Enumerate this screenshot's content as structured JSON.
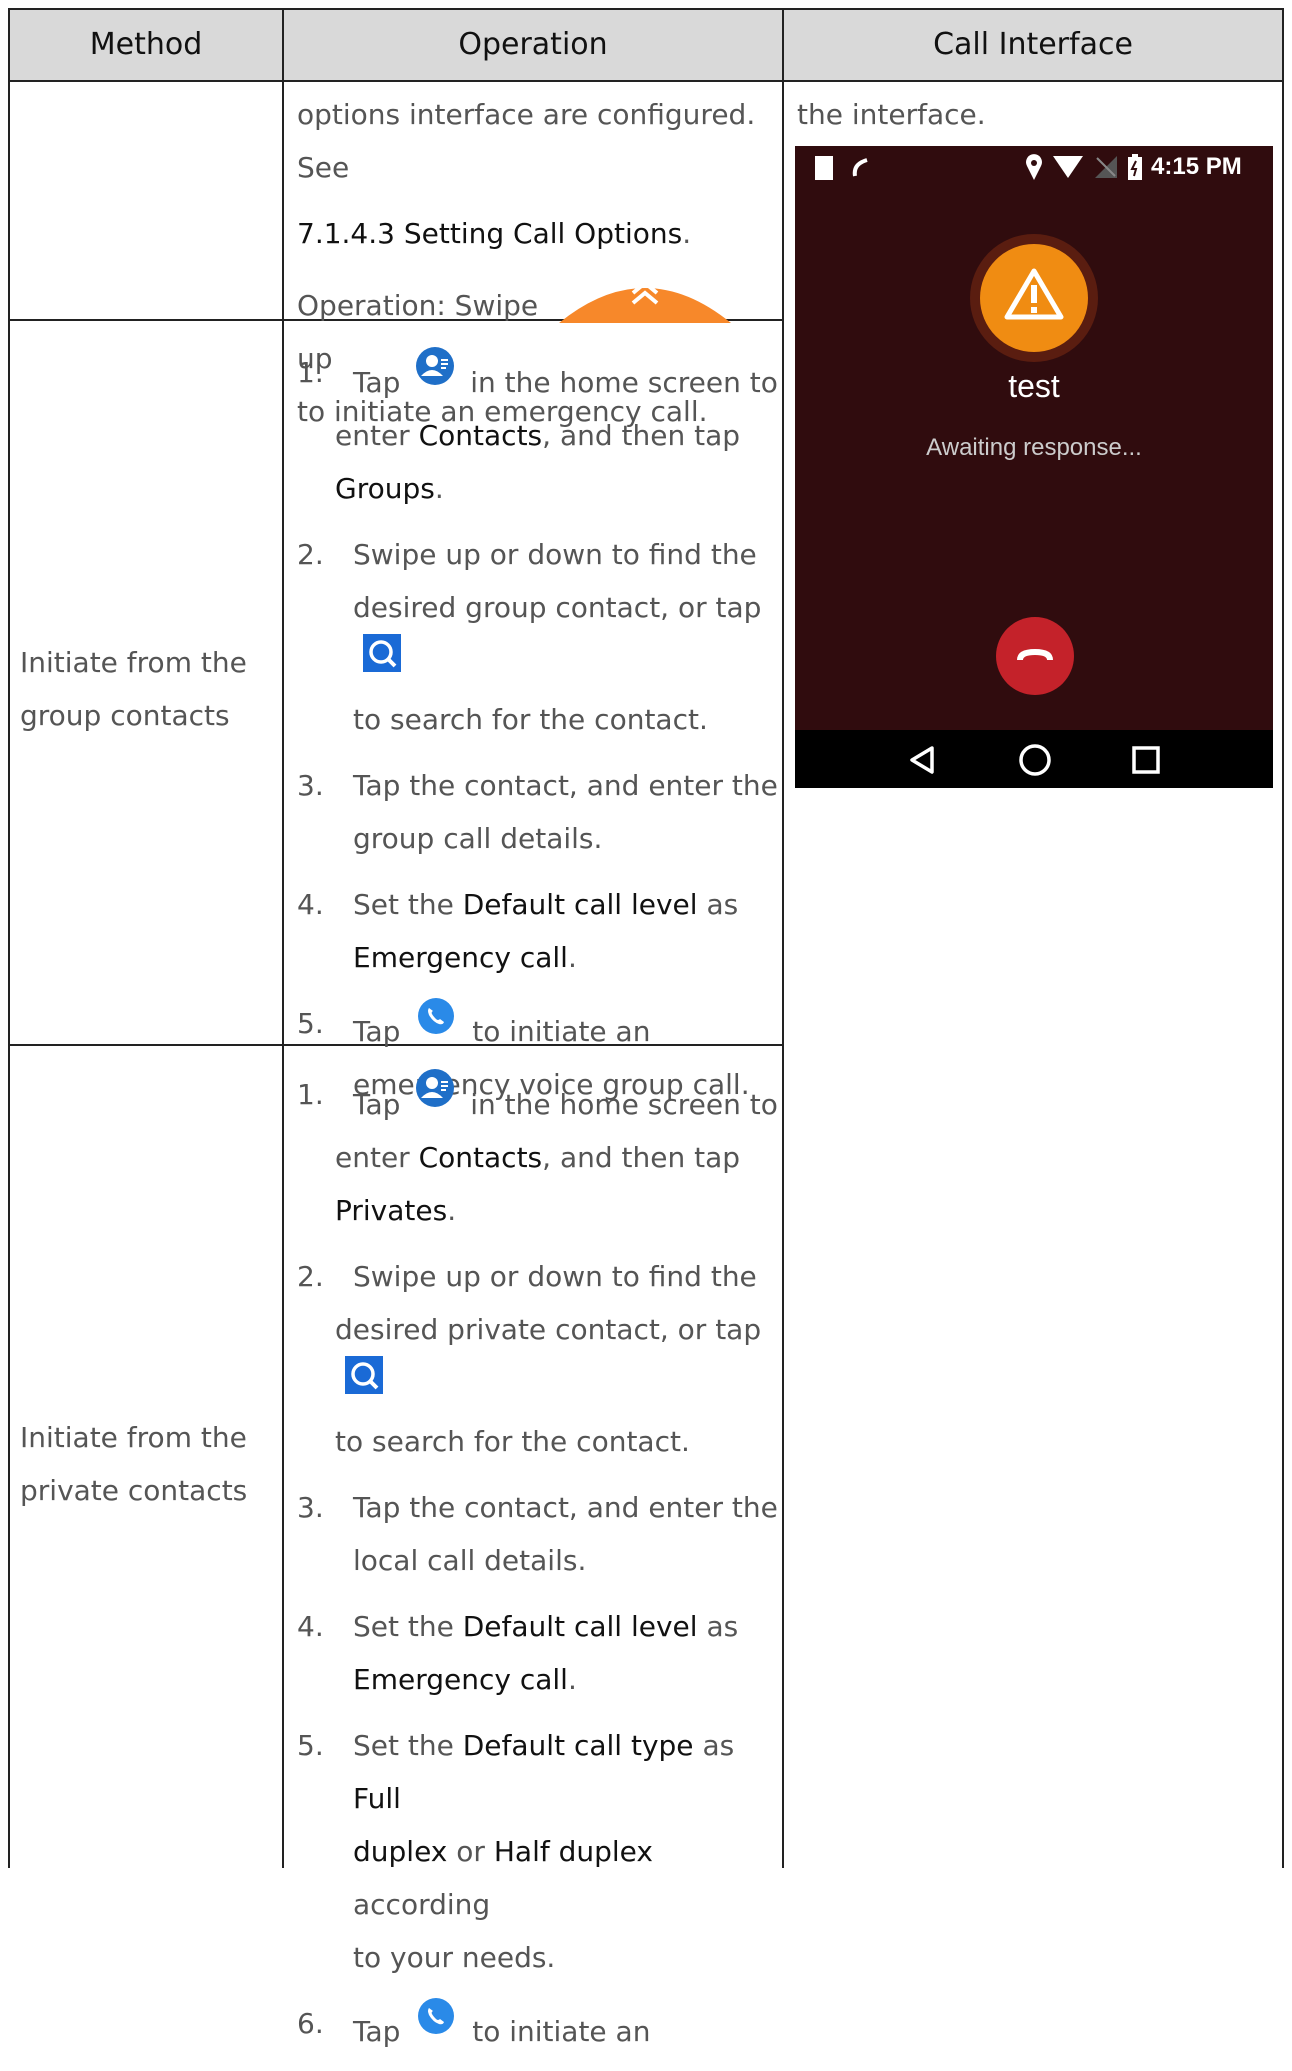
{
  "headers": {
    "method": "Method",
    "operation": "Operation",
    "call_interface": "Call Interface"
  },
  "row1": {
    "op_line1": "options interface are configured. See",
    "op_link": "7.1.4.3 Setting Call Options",
    "op_swipe_prefix": "Operation: Swipe",
    "op_swipe_suffix": "up",
    "op_last": "to initiate an emergency call.",
    "interface_note": "the interface."
  },
  "row2": {
    "method": [
      "Initiate from the",
      "group contacts"
    ],
    "steps": {
      "s1": {
        "num": "1.",
        "a": "Tap",
        "b": "in the home screen to",
        "c": "enter",
        "contacts": "Contacts",
        "d": ", and then tap",
        "groups": "Groups",
        "e": "."
      },
      "s2": {
        "num": "2.",
        "a": "Swipe up or down to find the",
        "b": "desired group contact, or tap",
        "c": "to search for the contact."
      },
      "s3": {
        "num": "3.",
        "a": "Tap the contact, and enter the",
        "b": "group call details."
      },
      "s4": {
        "num": "4.",
        "a": "Set the",
        "level": "Default call level",
        "b": "as",
        "emergency": "Emergency call",
        "c": "."
      },
      "s5": {
        "num": "5.",
        "a": "Tap",
        "b": "to initiate an",
        "c": "emergency voice group call."
      }
    }
  },
  "row3": {
    "method": [
      "Initiate from the",
      "private contacts"
    ],
    "steps": {
      "s1": {
        "num": "1.",
        "a": "Tap",
        "b": "in the home screen to",
        "c": "enter",
        "contacts": "Contacts",
        "d": ", and then tap",
        "privates": "Privates",
        "e": "."
      },
      "s2": {
        "num": "2.",
        "a": "Swipe up or down to find the",
        "b": "desired private contact, or tap",
        "c": "to search for the contact."
      },
      "s3": {
        "num": "3.",
        "a": "Tap the contact, and enter the",
        "b": "local call details."
      },
      "s4": {
        "num": "4.",
        "a": "Set the",
        "level": "Default call level",
        "b": "as",
        "emergency": "Emergency call",
        "c": "."
      },
      "s5": {
        "num": "5.",
        "a": "Set the",
        "type": "Default call type",
        "b": "as",
        "full": "Full",
        "duplex": "duplex",
        "or": "or",
        "half": "Half duplex",
        "c": "according",
        "d": "to your needs."
      },
      "s6": {
        "num": "6.",
        "a": "Tap",
        "b": "to initiate an"
      }
    }
  },
  "phone": {
    "time": "4:15 PM",
    "contact_name": "test",
    "status_text": "Awaiting response..."
  },
  "colors": {
    "header_bg": "#d9d9d9",
    "phone_bg": "#300c0e",
    "orange": "#f28c18",
    "hangup_red": "#c4222a",
    "contact_blue": "#1f6fc8",
    "search_blue": "#1a6ad6"
  },
  "icons": [
    "swipe-emergency-icon",
    "contacts-icon",
    "search-icon",
    "call-icon",
    "warning-icon",
    "hangup-icon",
    "back-icon",
    "home-icon",
    "recents-icon"
  ]
}
